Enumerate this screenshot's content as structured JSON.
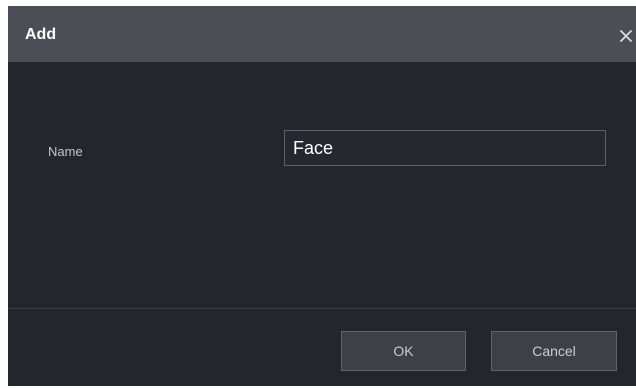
{
  "dialog": {
    "title": "Add",
    "close_icon": "close-icon"
  },
  "form": {
    "name_label": "Name",
    "name_value": "Face"
  },
  "footer": {
    "ok_label": "OK",
    "cancel_label": "Cancel"
  }
}
